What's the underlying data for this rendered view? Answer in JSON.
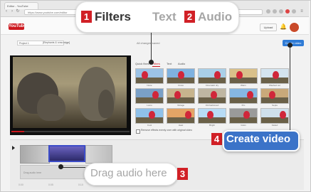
{
  "browser": {
    "tab_title": "Editor - YouTube",
    "url": "https://www.youtube.com/editor"
  },
  "youtube": {
    "logo_text": "YouTube",
    "upload_label": "Upload"
  },
  "editor": {
    "project_name": "Project 1",
    "project_title": "[Elephants & crow edge]",
    "saved_status": "All changes saved",
    "create_button_small": "Create video",
    "tabs": [
      "Quick fixes",
      "Filters",
      "Text",
      "Audio"
    ],
    "filters": [
      {
        "label": "None"
      },
      {
        "label": "Cross"
      },
      {
        "label": "Cinematic dry"
      },
      {
        "label": "Warm"
      },
      {
        "label": "Washed out"
      },
      {
        "label": "Lomo"
      },
      {
        "label": "Vintage"
      },
      {
        "label": "Old fashioned"
      },
      {
        "label": "Pro"
      },
      {
        "label": "Sepia"
      },
      {
        "label": "Cool"
      },
      {
        "label": "Heat"
      },
      {
        "label": "Bright"
      },
      {
        "label": "Grain"
      },
      {
        "label": "Faded"
      }
    ],
    "checkbox_label": "Remove effects evenly over with original video",
    "audio_track_text": "Drag audio here",
    "timeline_ticks": [
      "0:00",
      "0:05",
      "0:10"
    ]
  },
  "callouts": {
    "filters": {
      "num": "1",
      "label": "Filters"
    },
    "text": {
      "label": "Text"
    },
    "audio": {
      "num": "2",
      "label": "Audio"
    },
    "create": {
      "num": "4",
      "label": "Create video"
    },
    "drag": {
      "num": "3",
      "label": "Drag audio here"
    }
  },
  "colors": {
    "callout_number_red": "#d12026",
    "create_button_blue": "#3b73c8",
    "filters_label": "#333333",
    "text_audio_label": "#a6a6a6"
  }
}
